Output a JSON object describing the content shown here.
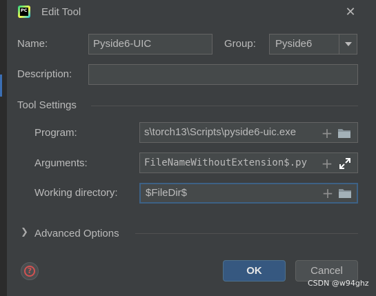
{
  "window": {
    "title": "Edit Tool",
    "app_icon_text": "PC",
    "close_icon": "close-icon"
  },
  "form": {
    "name_label": "Name:",
    "name_value": "Pyside6-UIC",
    "group_label": "Group:",
    "group_value": "Pyside6",
    "description_label": "Description:",
    "description_value": ""
  },
  "tool_settings": {
    "header": "Tool Settings",
    "program_label": "Program:",
    "program_value": "s\\torch13\\Scripts\\pyside6-uic.exe",
    "arguments_label": "Arguments:",
    "arguments_value": "FileNameWithoutExtension$.py",
    "working_dir_label": "Working directory:",
    "working_dir_value": "$FileDir$"
  },
  "advanced": {
    "label": "Advanced Options"
  },
  "buttons": {
    "ok": "OK",
    "cancel": "Cancel",
    "help_icon": "help-icon"
  },
  "watermark": "CSDN @w94ghz",
  "colors": {
    "background": "#3c3f41",
    "field": "#45494a",
    "ok_button": "#365880",
    "focus_border": "#3d6185",
    "help_red": "#d25252"
  }
}
